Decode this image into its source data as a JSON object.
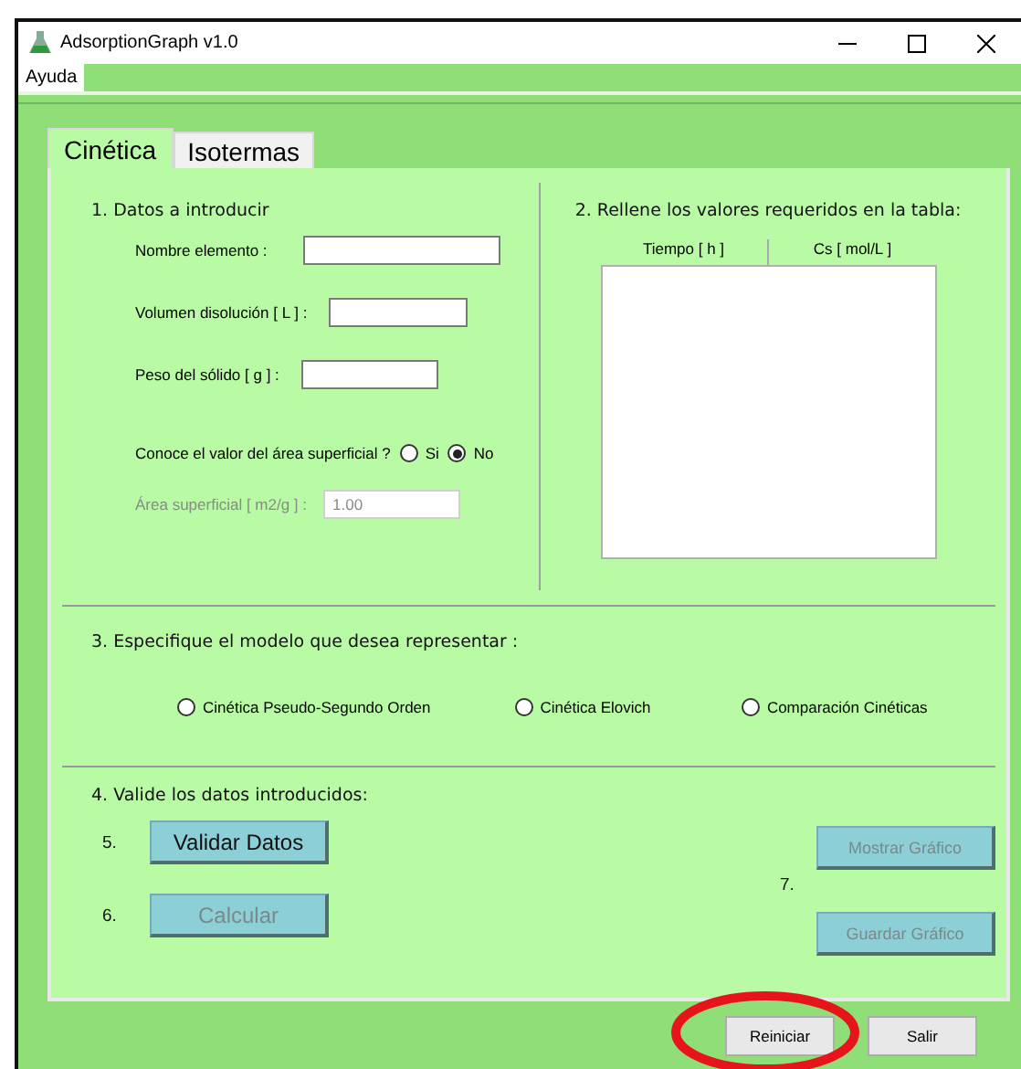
{
  "window": {
    "title": "AdsorptionGraph v1.0"
  },
  "menu": [
    {
      "label": "Ayuda",
      "selected": true
    }
  ],
  "tabs": [
    {
      "label": "Cinética",
      "selected": true
    },
    {
      "label": "Isotermas",
      "selected": false
    }
  ],
  "section_1": {
    "title": "1.  Datos a introducir",
    "fields": [
      {
        "label": "Nombre elemento :",
        "disabled": false
      },
      {
        "label": "Volumen disolución [ L ] :",
        "disabled": false
      },
      {
        "label": "Peso del sólido [ g ] :",
        "disabled": false
      }
    ],
    "area_question": {
      "label": "Conoce el valor del área superficial ?",
      "options": [
        {
          "label": "Si",
          "selected": false
        },
        {
          "label": "No",
          "selected": true
        }
      ]
    },
    "area_field": {
      "label": "Área superficial [ m2/g ] :",
      "value": "1.00",
      "disabled": true
    }
  },
  "section_2": {
    "title": "2. Rellene los valores requeridos en la tabla:",
    "columns": [
      "Tiempo [ h  ]",
      "Cs [ mol/L ]"
    ]
  },
  "section_3": {
    "title": "3. Especifique el modelo que desea representar :",
    "models": [
      {
        "label": "Cinética Pseudo-Segundo Orden",
        "selected": false
      },
      {
        "label": "Cinética Elovich",
        "selected": false
      },
      {
        "label": "Comparación Cinéticas",
        "selected": false
      }
    ]
  },
  "section_4": {
    "title": "4. Valide los datos introducidos:",
    "left_steps": [
      {
        "number": "5.",
        "button": "Validar Datos",
        "disabled": false
      },
      {
        "number": "6.",
        "button": "Calcular",
        "disabled": true
      }
    ],
    "right_step": {
      "number": "7.",
      "buttons": [
        {
          "label": "Mostrar Gráfico",
          "disabled": true
        },
        {
          "label": "Guardar Gráfico",
          "disabled": true
        }
      ]
    }
  },
  "footer_buttons": [
    {
      "label": "Reiniciar",
      "circled": true
    },
    {
      "label": "Salir",
      "circled": false
    }
  ]
}
